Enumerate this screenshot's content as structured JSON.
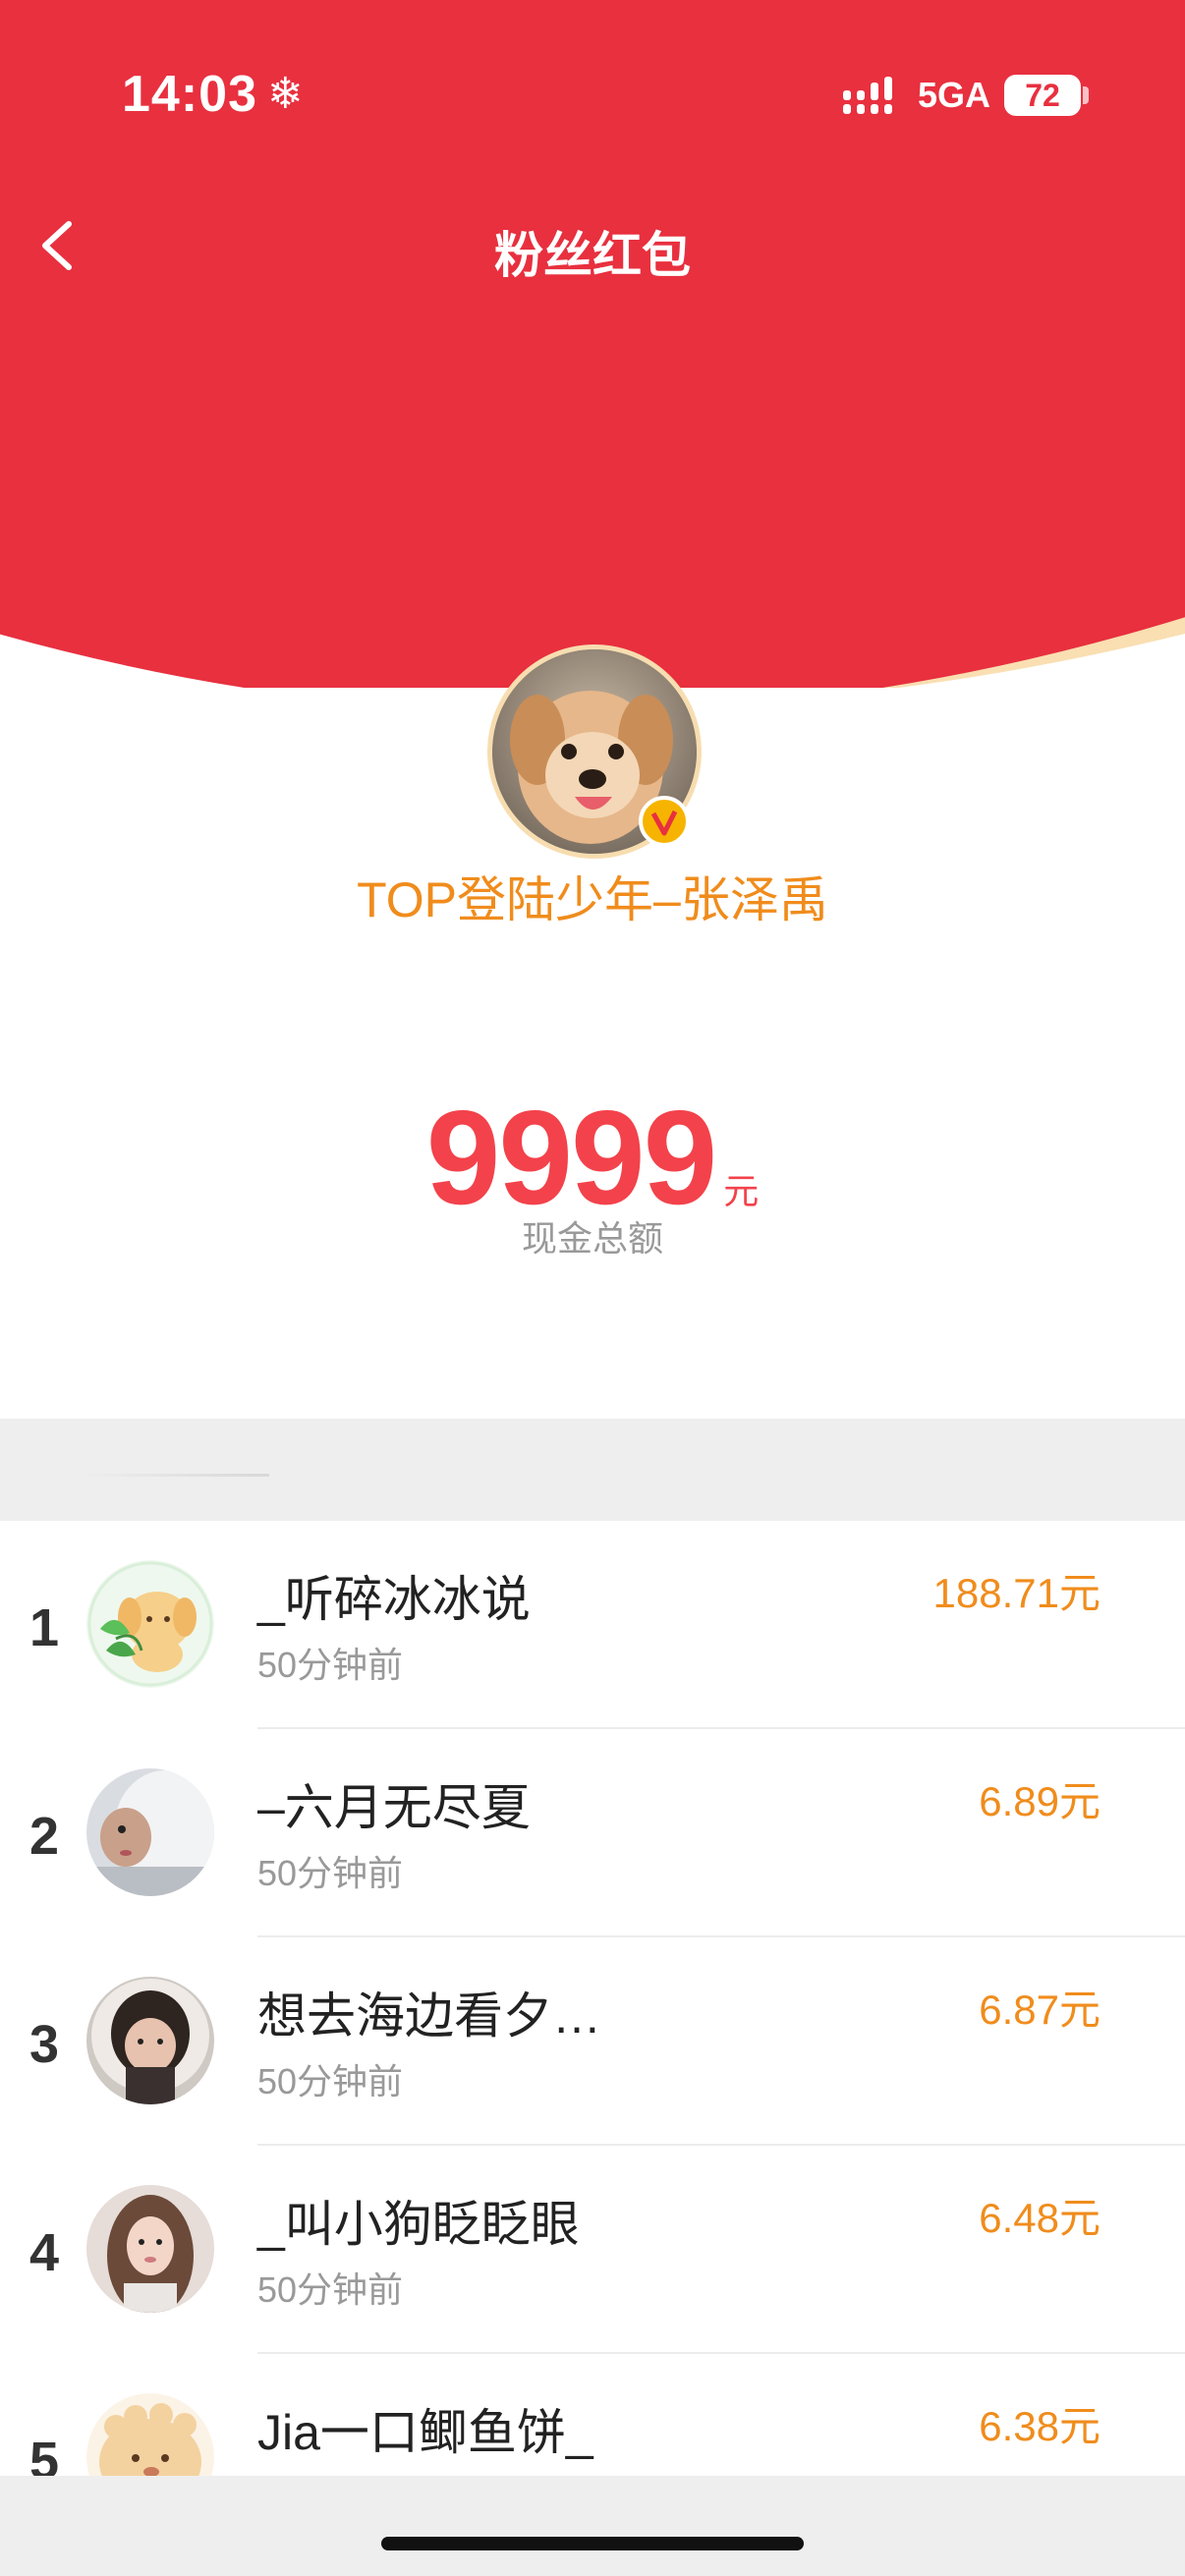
{
  "status_bar": {
    "time": "14:03",
    "network": "5GA",
    "battery": "72"
  },
  "nav": {
    "title": "粉丝红包"
  },
  "host": {
    "name": "TOP登陆少年–张泽禹"
  },
  "amount": {
    "value": "9999",
    "unit": "元",
    "label": "现金总额"
  },
  "colors": {
    "header_red": "#e8303f",
    "accent_orange": "#f08c1c",
    "amount_red": "#f3424b"
  },
  "receivers": [
    {
      "rank": "1",
      "name": "_听碎冰冰说",
      "time": "50分钟前",
      "amount": "188.71元"
    },
    {
      "rank": "2",
      "name": "–六月无尽夏",
      "time": "50分钟前",
      "amount": "6.89元"
    },
    {
      "rank": "3",
      "name": "想去海边看夕…",
      "time": "50分钟前",
      "amount": "6.87元"
    },
    {
      "rank": "4",
      "name": "_叫小狗眨眨眼",
      "time": "50分钟前",
      "amount": "6.48元"
    },
    {
      "rank": "5",
      "name": "Jia一口鲫鱼饼_",
      "time": "",
      "amount": "6.38元"
    }
  ]
}
